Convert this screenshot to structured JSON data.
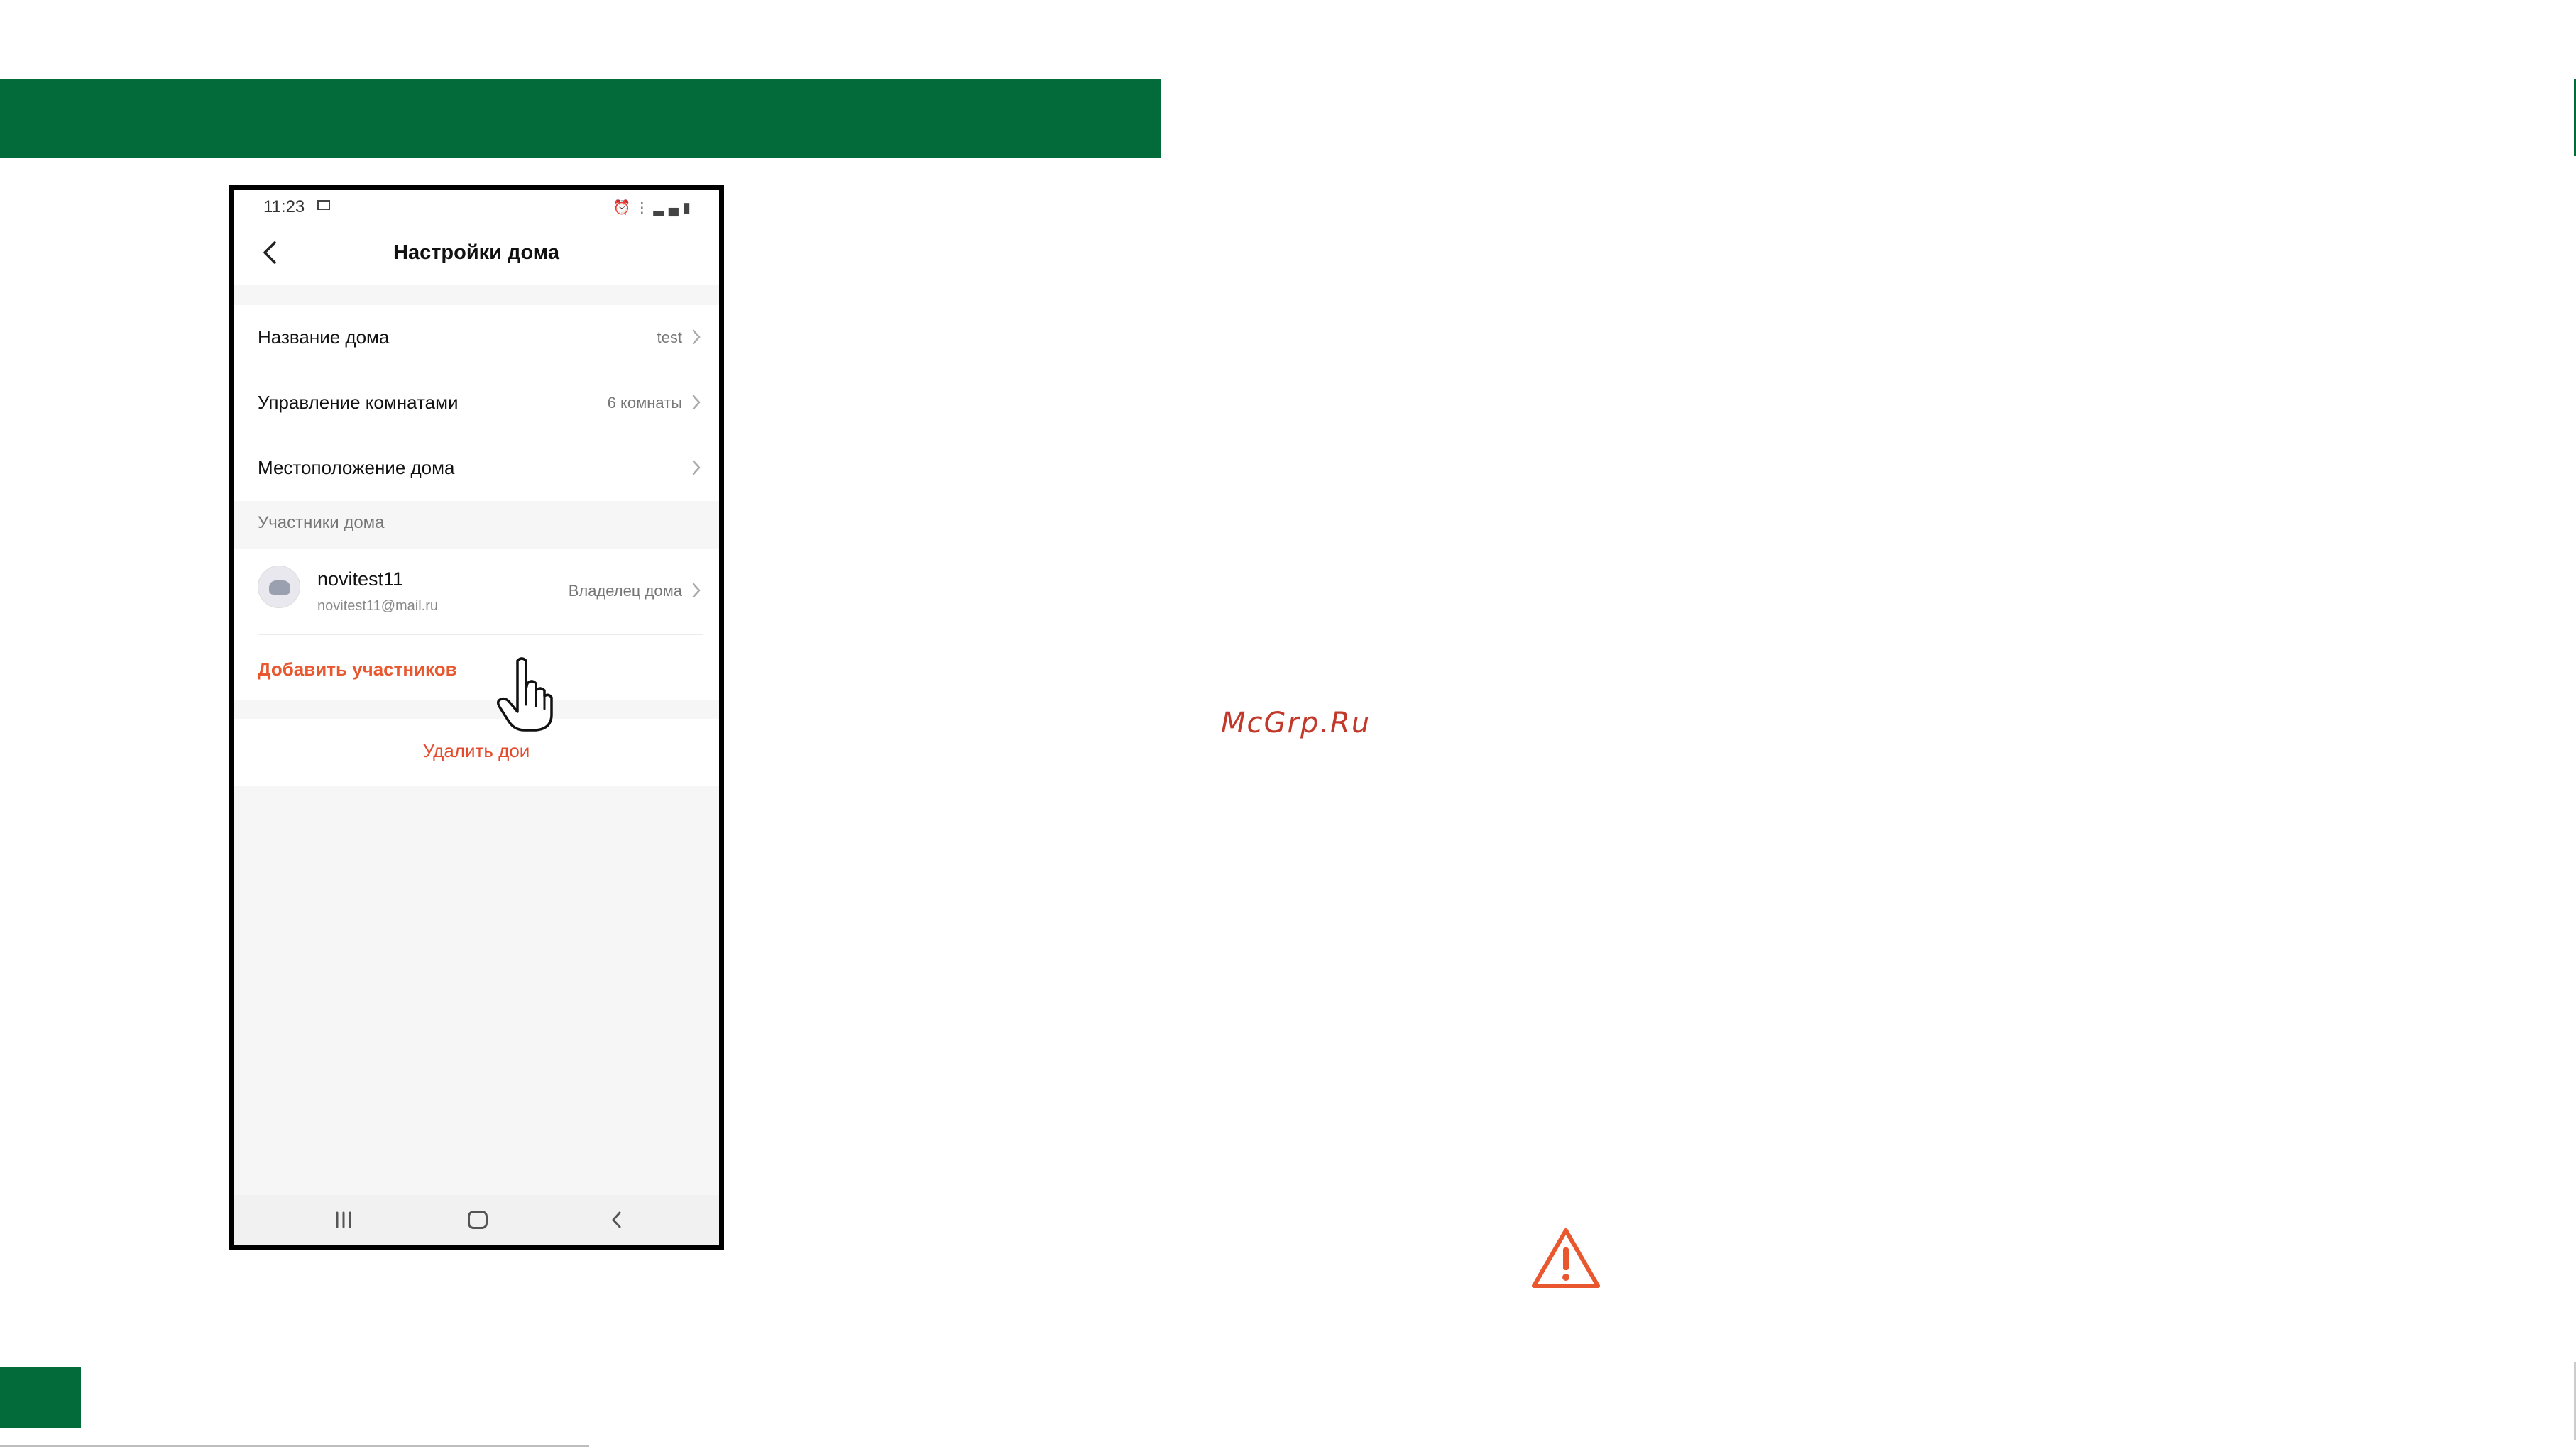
{
  "page": {
    "watermark": "McGrp.Ru",
    "colors": {
      "brand_green": "#036a3a",
      "accent_orange": "#e8572e",
      "danger_red": "#e34b2c"
    }
  },
  "status_bar": {
    "time": "11:23",
    "icons": [
      "image-icon",
      "alarm-icon",
      "wifi-icon",
      "signal-icon",
      "battery-icon"
    ]
  },
  "header": {
    "title": "Настройки дома",
    "back_icon": "chevron-left-icon"
  },
  "settings": {
    "items": [
      {
        "label": "Название дома",
        "value": "test"
      },
      {
        "label": "Управление комнатами",
        "value": "6 комнаты"
      },
      {
        "label": "Местоположение дома",
        "value": ""
      }
    ]
  },
  "members": {
    "section_label": "Участники дома",
    "list": [
      {
        "name": "novitest11",
        "email": "novitest11@mail.ru",
        "role": "Владелец дома"
      }
    ],
    "add_label": "Добавить участников"
  },
  "actions": {
    "delete_label": "Удалить дои"
  },
  "nav_bar": {
    "icons": [
      "recent-apps-icon",
      "home-icon",
      "back-icon"
    ]
  },
  "decorations": {
    "pointer": "hand-pointer-icon",
    "warning": "warning-triangle-icon"
  }
}
